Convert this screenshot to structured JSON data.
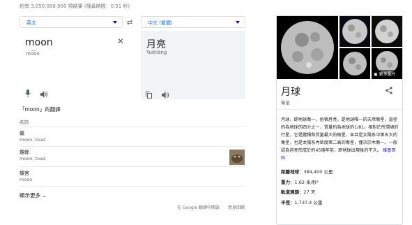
{
  "result_stats": "約有 3,050,000,000 項結果 (搜尋時間：0.51 秒)",
  "translate": {
    "source_lang": "英文",
    "target_lang": "中文 (繁體)",
    "source_text": "moon",
    "source_romanization": "mo͞on",
    "target_text": "月亮",
    "target_romanization": "Yuèliàng",
    "translations_title": "「moon」的翻譯",
    "part_of_speech": "名詞",
    "entries": [
      {
        "word": "蟾",
        "gloss": "moon, toad"
      },
      {
        "word": "蟾蜍",
        "gloss": "moon, toad"
      },
      {
        "word": "蟾宮",
        "gloss": "moon"
      }
    ],
    "show_more": "顯示更多",
    "open_in_translate": "在 Google 翻譯中開啟",
    "feedback": "意見回饋"
  },
  "icons": {
    "swap": "swap-arrows-icon",
    "clear": "close-icon",
    "mic": "microphone-icon",
    "speaker": "speaker-icon",
    "copy": "copy-icon",
    "share": "share-icon",
    "chevron": "chevron-down-icon",
    "images": "image-gallery-icon"
  },
  "knowledge_panel": {
    "more_images": "更多圖片",
    "title": "月球",
    "subtitle": "衛星",
    "description": "月球，即地球衛一，俗稱月亮，是地球唯一的天然衛星，直徑約為地球的四分之一，質量約為地球的1/81，相對於所環繞的行星，它是體積和質量最大的衛星，並且是太陽系中第五大的衛星，也是太陽系內密度第二高的衛星，僅次於木衛一。一般認為月亮形成於約45億年前，即地球出現後的不久。",
    "source_link": "維基百科",
    "facts": [
      {
        "label": "距離地球",
        "value": "384,400 公里"
      },
      {
        "label": "重力",
        "value": "1.62 米/秒²"
      },
      {
        "label": "軌道週期",
        "value": "27 天"
      },
      {
        "label": "半徑",
        "value": "1,737.4 公里"
      }
    ]
  },
  "colors": {
    "link": "#1a0dab",
    "accent": "#1a73e8",
    "muted": "#5f6368"
  }
}
